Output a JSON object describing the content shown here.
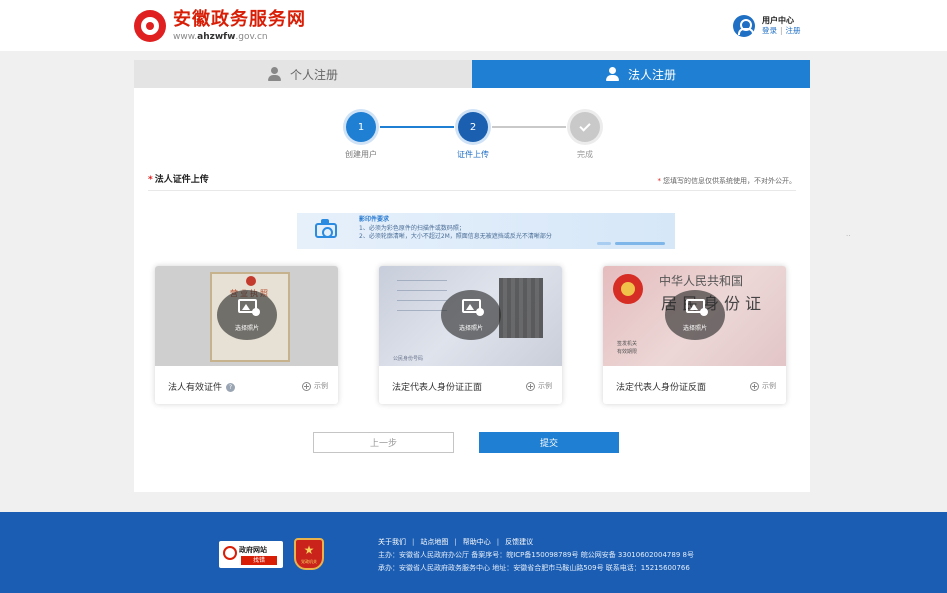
{
  "header": {
    "site_title": "安徽政务服务网",
    "site_url_prefix": "www.",
    "site_url_bold": "ahzwfw",
    "site_url_suffix": ".gov.cn",
    "user_center_title": "用户中心",
    "login_link": "登录",
    "separator": "|",
    "register_link": "注册"
  },
  "tabs": {
    "personal": "个人注册",
    "corporate": "法人注册",
    "active": "corporate"
  },
  "steps": [
    {
      "number": "1",
      "label": "创建用户",
      "state": "done"
    },
    {
      "number": "2",
      "label": "证件上传",
      "state": "current"
    },
    {
      "number": "",
      "label": "完成",
      "state": "pending"
    }
  ],
  "section": {
    "required_mark": "*",
    "title": "法人证件上传",
    "note": "您填写的信息仅供系统使用，不对外公开。"
  },
  "requirements": {
    "title": "影印件要求",
    "line1": "1、必须为彩色原件的扫描件或数码照；",
    "line2": "2、必须轮廓清晰，大小不超过2M，照面信息无被遮挡或反光不清晰部分"
  },
  "uploads": [
    {
      "caption": "法人有效证件",
      "choose_label": "选择照片",
      "example_label": "示例",
      "has_help": true,
      "doc_title": "营业执照"
    },
    {
      "caption": "法定代表人身份证正面",
      "choose_label": "选择照片",
      "example_label": "示例",
      "has_help": false,
      "idno_label": "公民身份号码"
    },
    {
      "caption": "法定代表人身份证反面",
      "choose_label": "选择照片",
      "example_label": "示例",
      "has_help": false,
      "line1": "中华人民共和国",
      "line2": "居民身份证",
      "sign_label": "签发机关",
      "valid_label": "有效期限"
    }
  ],
  "help_glyph": "?",
  "side_text": "..",
  "buttons": {
    "prev": "上一步",
    "submit": "提交"
  },
  "footer": {
    "badge_gov_title": "政府网站",
    "badge_gov_sub": "找错",
    "badge_party_label": "党政机关",
    "links": [
      "关于我们",
      "站点地图",
      "帮助中心",
      "反馈建议"
    ],
    "line1": "主办：安徽省人民政府办公厅  备案序号：皖ICP备150098789号   皖公网安备 33010602004789 8号",
    "line2": "承办：安徽省人民政府政务服务中心  地址：安徽省合肥市马鞍山路509号  联系电话：15215600766"
  },
  "colors": {
    "brand_red": "#d81e06",
    "accent_blue": "#1f7fd3",
    "footer_blue": "#1b5db2"
  }
}
